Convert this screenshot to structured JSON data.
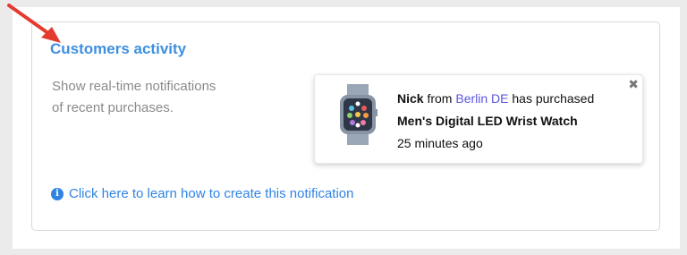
{
  "title": "Customers activity",
  "description": "Show real-time notifications of recent purchases.",
  "learn_more_link": "Click here to learn how to create this notification",
  "notification": {
    "name": "Nick",
    "from_word": "from",
    "location": "Berlin DE",
    "action": "has purchased",
    "product": "Men's Digital LED Wrist Watch",
    "time": "25 minutes ago"
  },
  "colors": {
    "title": "#3d8fe0",
    "link": "#2f84e3",
    "location": "#5a55e0",
    "arrow": "#e53b2f"
  }
}
